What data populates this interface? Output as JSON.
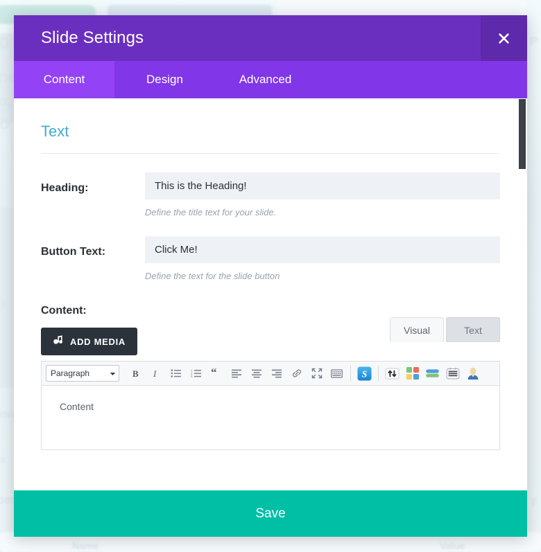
{
  "modal": {
    "title": "Slide Settings",
    "close_icon": "close-icon",
    "tabs": [
      {
        "label": "Content",
        "active": true
      },
      {
        "label": "Design",
        "active": false
      },
      {
        "label": "Advanced",
        "active": false
      }
    ],
    "section": {
      "title": "Text"
    },
    "fields": [
      {
        "label": "Heading:",
        "value": "This is the Heading!",
        "placeholder": "",
        "description": "Define the title text for your slide."
      },
      {
        "label": "Button Text:",
        "value": "Click Me!",
        "placeholder": "",
        "description": "Define the text for the slide button"
      }
    ],
    "content": {
      "label": "Content:",
      "add_media_label": "ADD MEDIA",
      "add_media_icon": "add-media-icon",
      "editor_tabs": [
        {
          "label": "Visual",
          "active": true
        },
        {
          "label": "Text",
          "active": false
        }
      ],
      "toolbar": {
        "format_select": "Paragraph",
        "buttons": [
          "bold-icon",
          "italic-icon",
          "bulleted-list-icon",
          "numbered-list-icon",
          "blockquote-icon",
          "align-left-icon",
          "align-center-icon",
          "align-right-icon",
          "link-icon",
          "fullscreen-icon",
          "toolbar-toggle-icon",
          "shortcodes-icon",
          "updown-arrows-icon",
          "grid-squares-icon",
          "stacked-bars-icon",
          "card-list-icon",
          "person-icon"
        ]
      },
      "editor_text": "Content"
    },
    "save_label": "Save"
  },
  "backdrop": {
    "labels": {
      "name_column": "Name",
      "value_column": "Value"
    },
    "ghost_texts": [
      "D",
      "ne",
      "o, L",
      "D",
      "s",
      "tion",
      "s",
      "om",
      "P",
      "F"
    ]
  },
  "colors": {
    "titlebar": "#6b2fc0",
    "close_button": "#5e29ab",
    "tabstrip": "#8136e8",
    "tab_active": "#9343f5",
    "section_title": "#41acd6",
    "input_bg": "#eef2f6",
    "add_media_bg": "#2b323b",
    "save_bg": "#00bfa5",
    "scrollbar": "#3c4148"
  }
}
